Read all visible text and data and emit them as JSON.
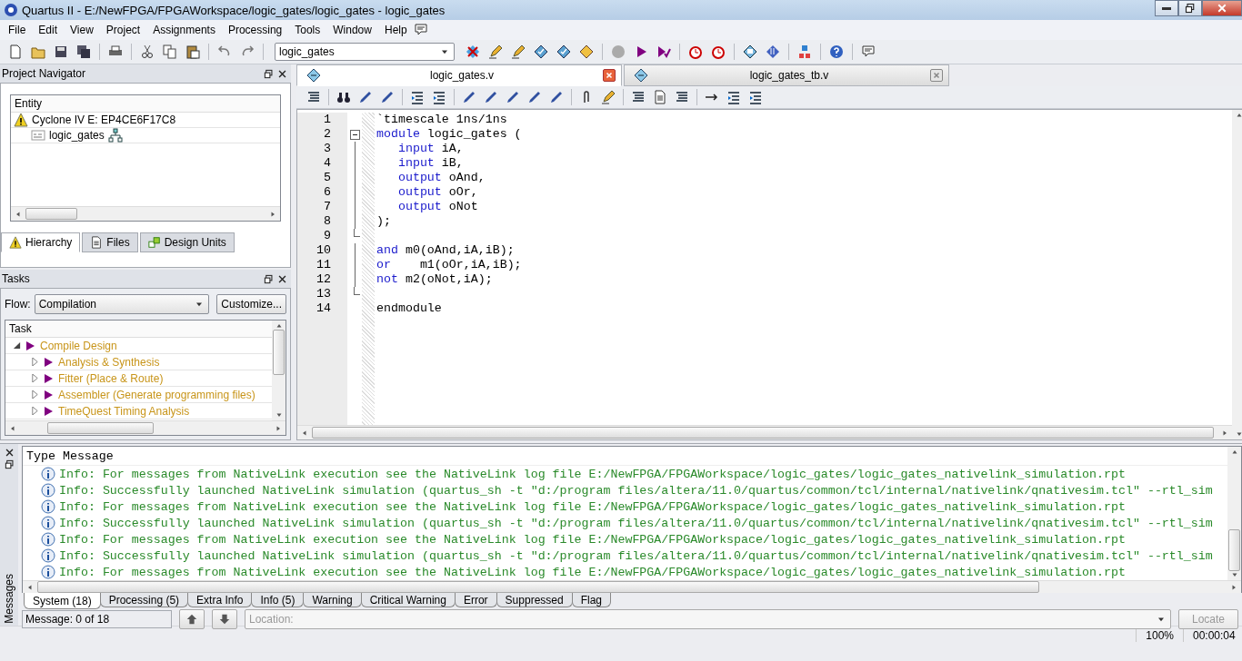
{
  "window": {
    "title": "Quartus II - E:/NewFPGA/FPGAWorkspace/logic_gates/logic_gates - logic_gates"
  },
  "menu": [
    "File",
    "Edit",
    "View",
    "Project",
    "Assignments",
    "Processing",
    "Tools",
    "Window",
    "Help"
  ],
  "toolbar": {
    "project_select": "logic_gates"
  },
  "project_navigator": {
    "title": "Project Navigator",
    "column": "Entity",
    "items": [
      {
        "label": "Cyclone IV E: EP4CE6F17C8",
        "kind": "device"
      },
      {
        "label": "logic_gates",
        "kind": "entity"
      }
    ],
    "tabs": [
      {
        "label": "Hierarchy",
        "selected": true
      },
      {
        "label": "Files",
        "selected": false
      },
      {
        "label": "Design Units",
        "selected": false
      }
    ]
  },
  "tasks": {
    "title": "Tasks",
    "flow_label": "Flow:",
    "flow": "Compilation",
    "customize": "Customize...",
    "column": "Task",
    "items": [
      {
        "label": "Compile Design",
        "expanded": true,
        "children": [
          {
            "label": "Analysis & Synthesis",
            "expanded": false
          },
          {
            "label": "Fitter (Place & Route)",
            "expanded": false
          },
          {
            "label": "Assembler (Generate programming files)",
            "expanded": false
          },
          {
            "label": "TimeQuest Timing Analysis",
            "expanded": false
          }
        ]
      }
    ]
  },
  "editor": {
    "tabs": [
      {
        "label": "logic_gates.v",
        "selected": true
      },
      {
        "label": "logic_gates_tb.v",
        "selected": false
      }
    ],
    "lines": [
      {
        "number": "1",
        "kind": "plain",
        "segments": [
          {
            "text": "`timescale 1ns/1ns",
            "kind": "plain"
          }
        ]
      },
      {
        "number": "2",
        "kind": "fold_start",
        "segments": [
          {
            "text": "module",
            "kind": "keyword"
          },
          {
            "text": " logic_gates (",
            "kind": "plain"
          }
        ]
      },
      {
        "number": "3",
        "kind": "fold_body",
        "segments": [
          {
            "text": "   input",
            "kind": "keyword"
          },
          {
            "text": " iA,",
            "kind": "plain"
          }
        ]
      },
      {
        "number": "4",
        "kind": "fold_body",
        "segments": [
          {
            "text": "   input",
            "kind": "keyword"
          },
          {
            "text": " iB,",
            "kind": "plain"
          }
        ]
      },
      {
        "number": "5",
        "kind": "fold_body",
        "segments": [
          {
            "text": "   output",
            "kind": "keyword"
          },
          {
            "text": " oAnd,",
            "kind": "plain"
          }
        ]
      },
      {
        "number": "6",
        "kind": "fold_body",
        "segments": [
          {
            "text": "   output",
            "kind": "keyword"
          },
          {
            "text": " oOr,",
            "kind": "plain"
          }
        ]
      },
      {
        "number": "7",
        "kind": "fold_body",
        "segments": [
          {
            "text": "   output",
            "kind": "keyword"
          },
          {
            "text": " oNot",
            "kind": "plain"
          }
        ]
      },
      {
        "number": "8",
        "kind": "fold_body",
        "segments": [
          {
            "text": ");",
            "kind": "plain"
          }
        ]
      },
      {
        "number": "9",
        "kind": "fold_end"
      },
      {
        "number": "10",
        "kind": "fold_body",
        "segments": [
          {
            "text": "and",
            "kind": "keyword"
          },
          {
            "text": " m0(oAnd,iA,iB);",
            "kind": "plain"
          }
        ]
      },
      {
        "number": "11",
        "kind": "fold_body",
        "segments": [
          {
            "text": "or",
            "kind": "keyword"
          },
          {
            "text": "    m1(oOr,iA,iB);",
            "kind": "plain"
          }
        ]
      },
      {
        "number": "12",
        "kind": "fold_body",
        "segments": [
          {
            "text": "not",
            "kind": "keyword"
          },
          {
            "text": " m2(oNot,iA);",
            "kind": "plain"
          }
        ]
      },
      {
        "number": "13",
        "kind": "fold_end"
      },
      {
        "number": "14",
        "kind": "plain",
        "segments": [
          {
            "text": "endmodule",
            "kind": "plain"
          }
        ]
      }
    ]
  },
  "messages": {
    "title": "Messages",
    "columns": [
      "Type",
      "Message"
    ],
    "rows": [
      {
        "kind": "info",
        "text": "Info: For messages from NativeLink execution see the NativeLink log file E:/NewFPGA/FPGAWorkspace/logic_gates/logic_gates_nativelink_simulation.rpt"
      },
      {
        "kind": "info",
        "text": "Info: Successfully launched NativeLink simulation (quartus_sh -t \"d:/program files/altera/11.0/quartus/common/tcl/internal/nativelink/qnativesim.tcl\" --rtl_sim"
      },
      {
        "kind": "info",
        "text": "Info: For messages from NativeLink execution see the NativeLink log file E:/NewFPGA/FPGAWorkspace/logic_gates/logic_gates_nativelink_simulation.rpt"
      },
      {
        "kind": "info",
        "text": "Info: Successfully launched NativeLink simulation (quartus_sh -t \"d:/program files/altera/11.0/quartus/common/tcl/internal/nativelink/qnativesim.tcl\" --rtl_sim"
      },
      {
        "kind": "info",
        "text": "Info: For messages from NativeLink execution see the NativeLink log file E:/NewFPGA/FPGAWorkspace/logic_gates/logic_gates_nativelink_simulation.rpt"
      },
      {
        "kind": "info",
        "text": "Info: Successfully launched NativeLink simulation (quartus_sh -t \"d:/program files/altera/11.0/quartus/common/tcl/internal/nativelink/qnativesim.tcl\" --rtl_sim"
      },
      {
        "kind": "info",
        "text": "Info: For messages from NativeLink execution see the NativeLink log file E:/NewFPGA/FPGAWorkspace/logic_gates/logic_gates_nativelink_simulation.rpt"
      }
    ],
    "tabs": [
      {
        "label": "System (18)",
        "selected": true
      },
      {
        "label": "Processing (5)",
        "selected": false
      },
      {
        "label": "Extra Info",
        "selected": false
      },
      {
        "label": "Info (5)",
        "selected": false
      },
      {
        "label": "Warning",
        "selected": false
      },
      {
        "label": "Critical Warning",
        "selected": false
      },
      {
        "label": "Error",
        "selected": false
      },
      {
        "label": "Suppressed",
        "selected": false
      },
      {
        "label": "Flag",
        "selected": false
      }
    ],
    "counter": "Message: 0 of 18",
    "location_placeholder": "Location:",
    "locate": {
      "label": "Locate",
      "disabled": true
    }
  },
  "status_bar": {
    "zoom": "100%",
    "time": "00:00:04"
  }
}
